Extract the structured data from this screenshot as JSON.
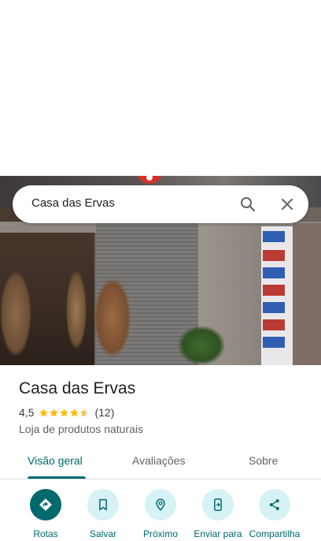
{
  "search": {
    "query": "Casa das Ervas"
  },
  "place": {
    "name": "Casa das Ervas",
    "rating": "4,5",
    "rating_stars": 4.5,
    "review_count": "(12)",
    "category": "Loja de produtos naturais"
  },
  "tabs": [
    {
      "label": "Visão geral"
    },
    {
      "label": "Avaliações"
    },
    {
      "label": "Sobre"
    }
  ],
  "actions": [
    {
      "label": "Rotas",
      "icon": "directions-icon"
    },
    {
      "label": "Salvar",
      "icon": "bookmark-icon"
    },
    {
      "label": "Próximo",
      "icon": "nearby-icon"
    },
    {
      "label": "Enviar para",
      "icon": "send-to-phone-icon"
    },
    {
      "label": "Compartilha",
      "icon": "share-icon"
    }
  ],
  "colors": {
    "accent": "#00696d",
    "action_bg": "#d6f2f5",
    "star": "#fbbc04"
  }
}
